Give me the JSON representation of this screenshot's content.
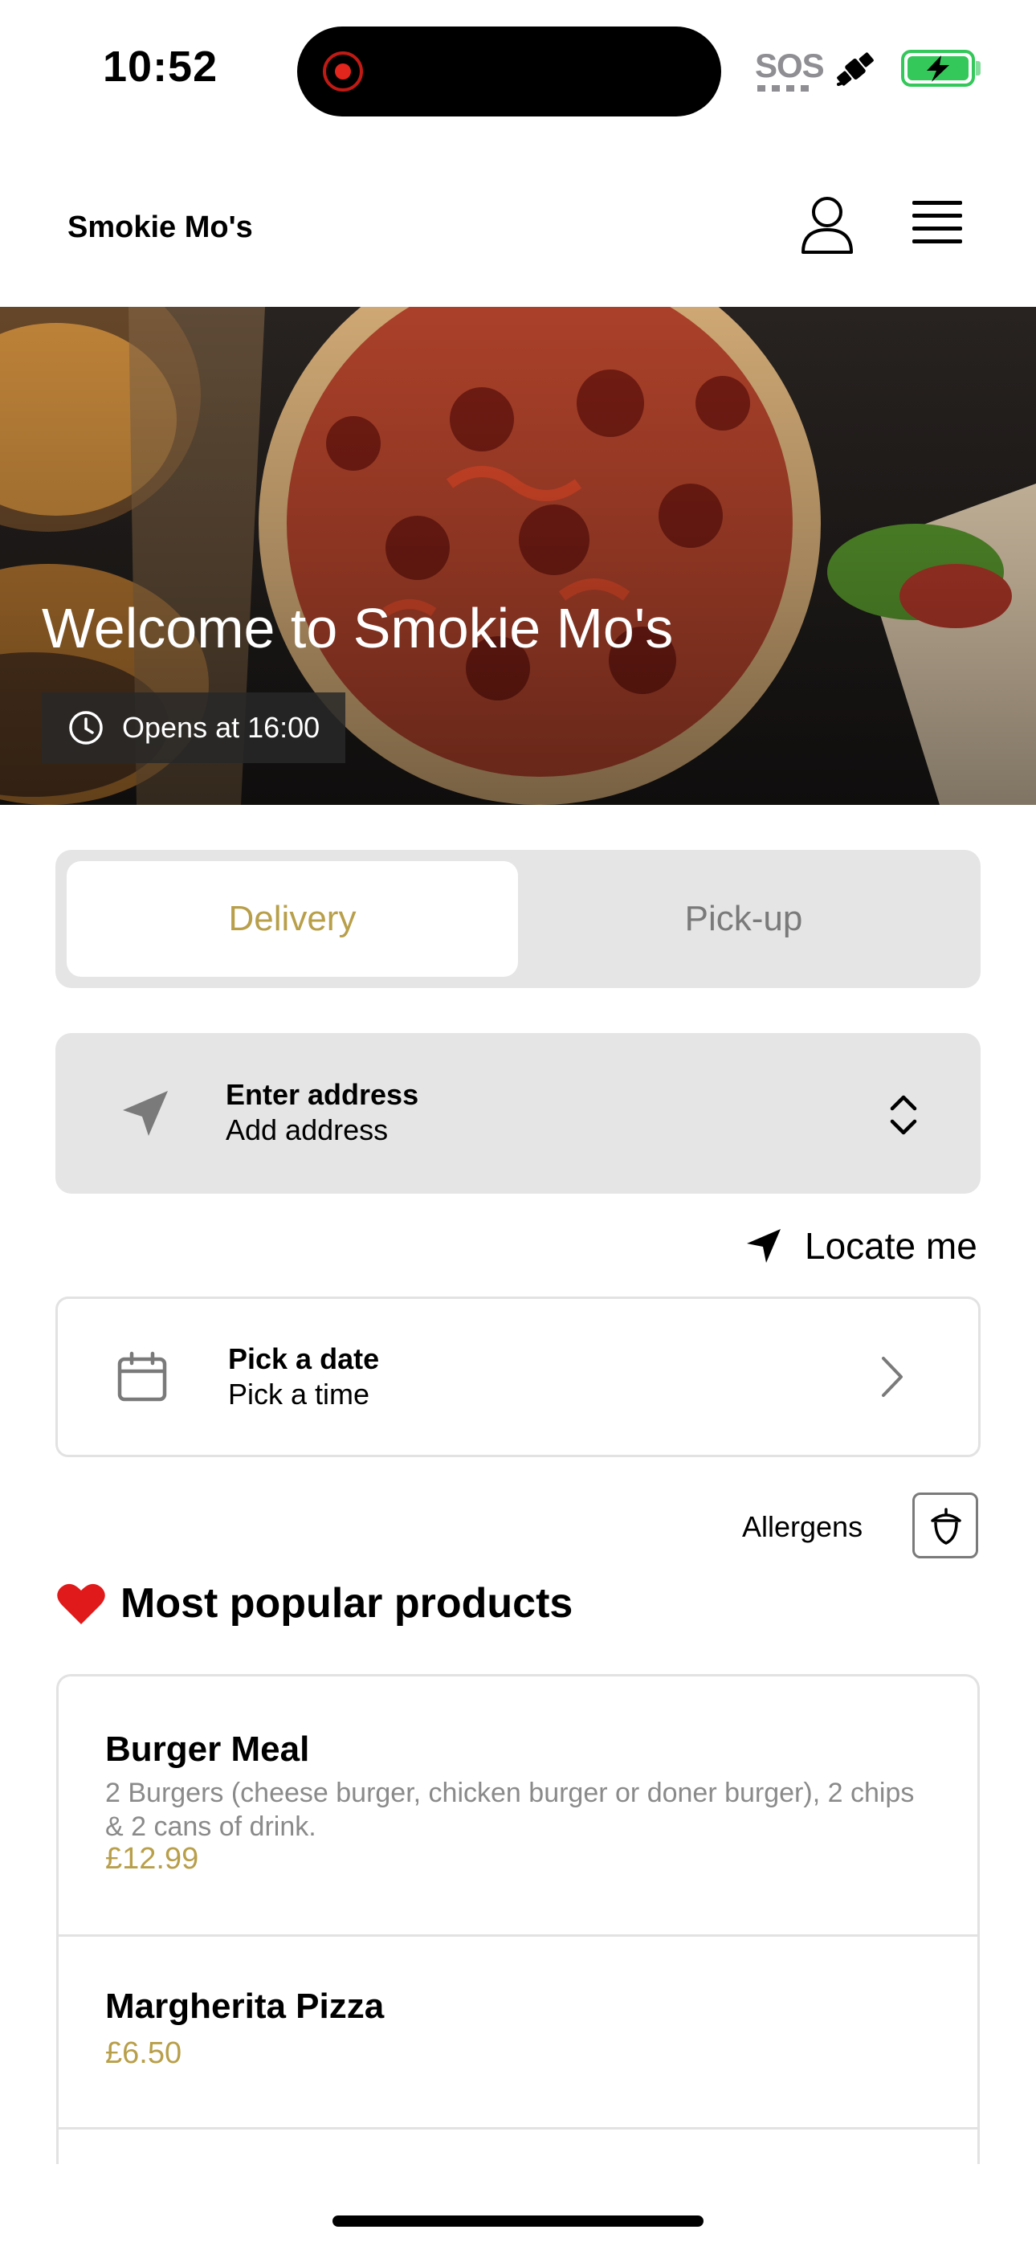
{
  "status_bar": {
    "time": "10:52",
    "sos": "SOS",
    "icons": [
      "recording-indicator-icon",
      "satellite-icon",
      "battery-charging-icon"
    ],
    "battery_color": "#34c759"
  },
  "header": {
    "brand": "Smokie Mo's",
    "icons": [
      "user-icon",
      "menu-icon"
    ]
  },
  "hero": {
    "title": "Welcome to Smokie Mo's",
    "hours": "Opens at 16:00",
    "hours_icon": "clock-icon"
  },
  "order_mode": {
    "tabs": [
      {
        "label": "Delivery",
        "active": true
      },
      {
        "label": "Pick-up",
        "active": false
      }
    ]
  },
  "address": {
    "label": "Enter address",
    "value": "Add address",
    "icon": "navigation-arrow-icon"
  },
  "locate_me": {
    "label": "Locate me",
    "icon": "location-arrow-icon"
  },
  "schedule": {
    "label": "Pick a date",
    "value": "Pick a time",
    "icon": "calendar-icon"
  },
  "allergens": {
    "label": "Allergens",
    "icon": "acorn-icon"
  },
  "popular": {
    "title": "Most popular products",
    "icon": "heart-icon",
    "products": [
      {
        "name": "Burger Meal",
        "description": "2 Burgers (cheese burger, chicken burger or doner burger), 2 chips & 2 cans of drink.",
        "price": "£12.99"
      },
      {
        "name": "Margherita Pizza",
        "description": "",
        "price": "£6.50"
      }
    ]
  },
  "colors": {
    "accent": "#b89f4a",
    "toggle_bg": "#e5e5e5",
    "muted_text": "#8a8a8a"
  }
}
